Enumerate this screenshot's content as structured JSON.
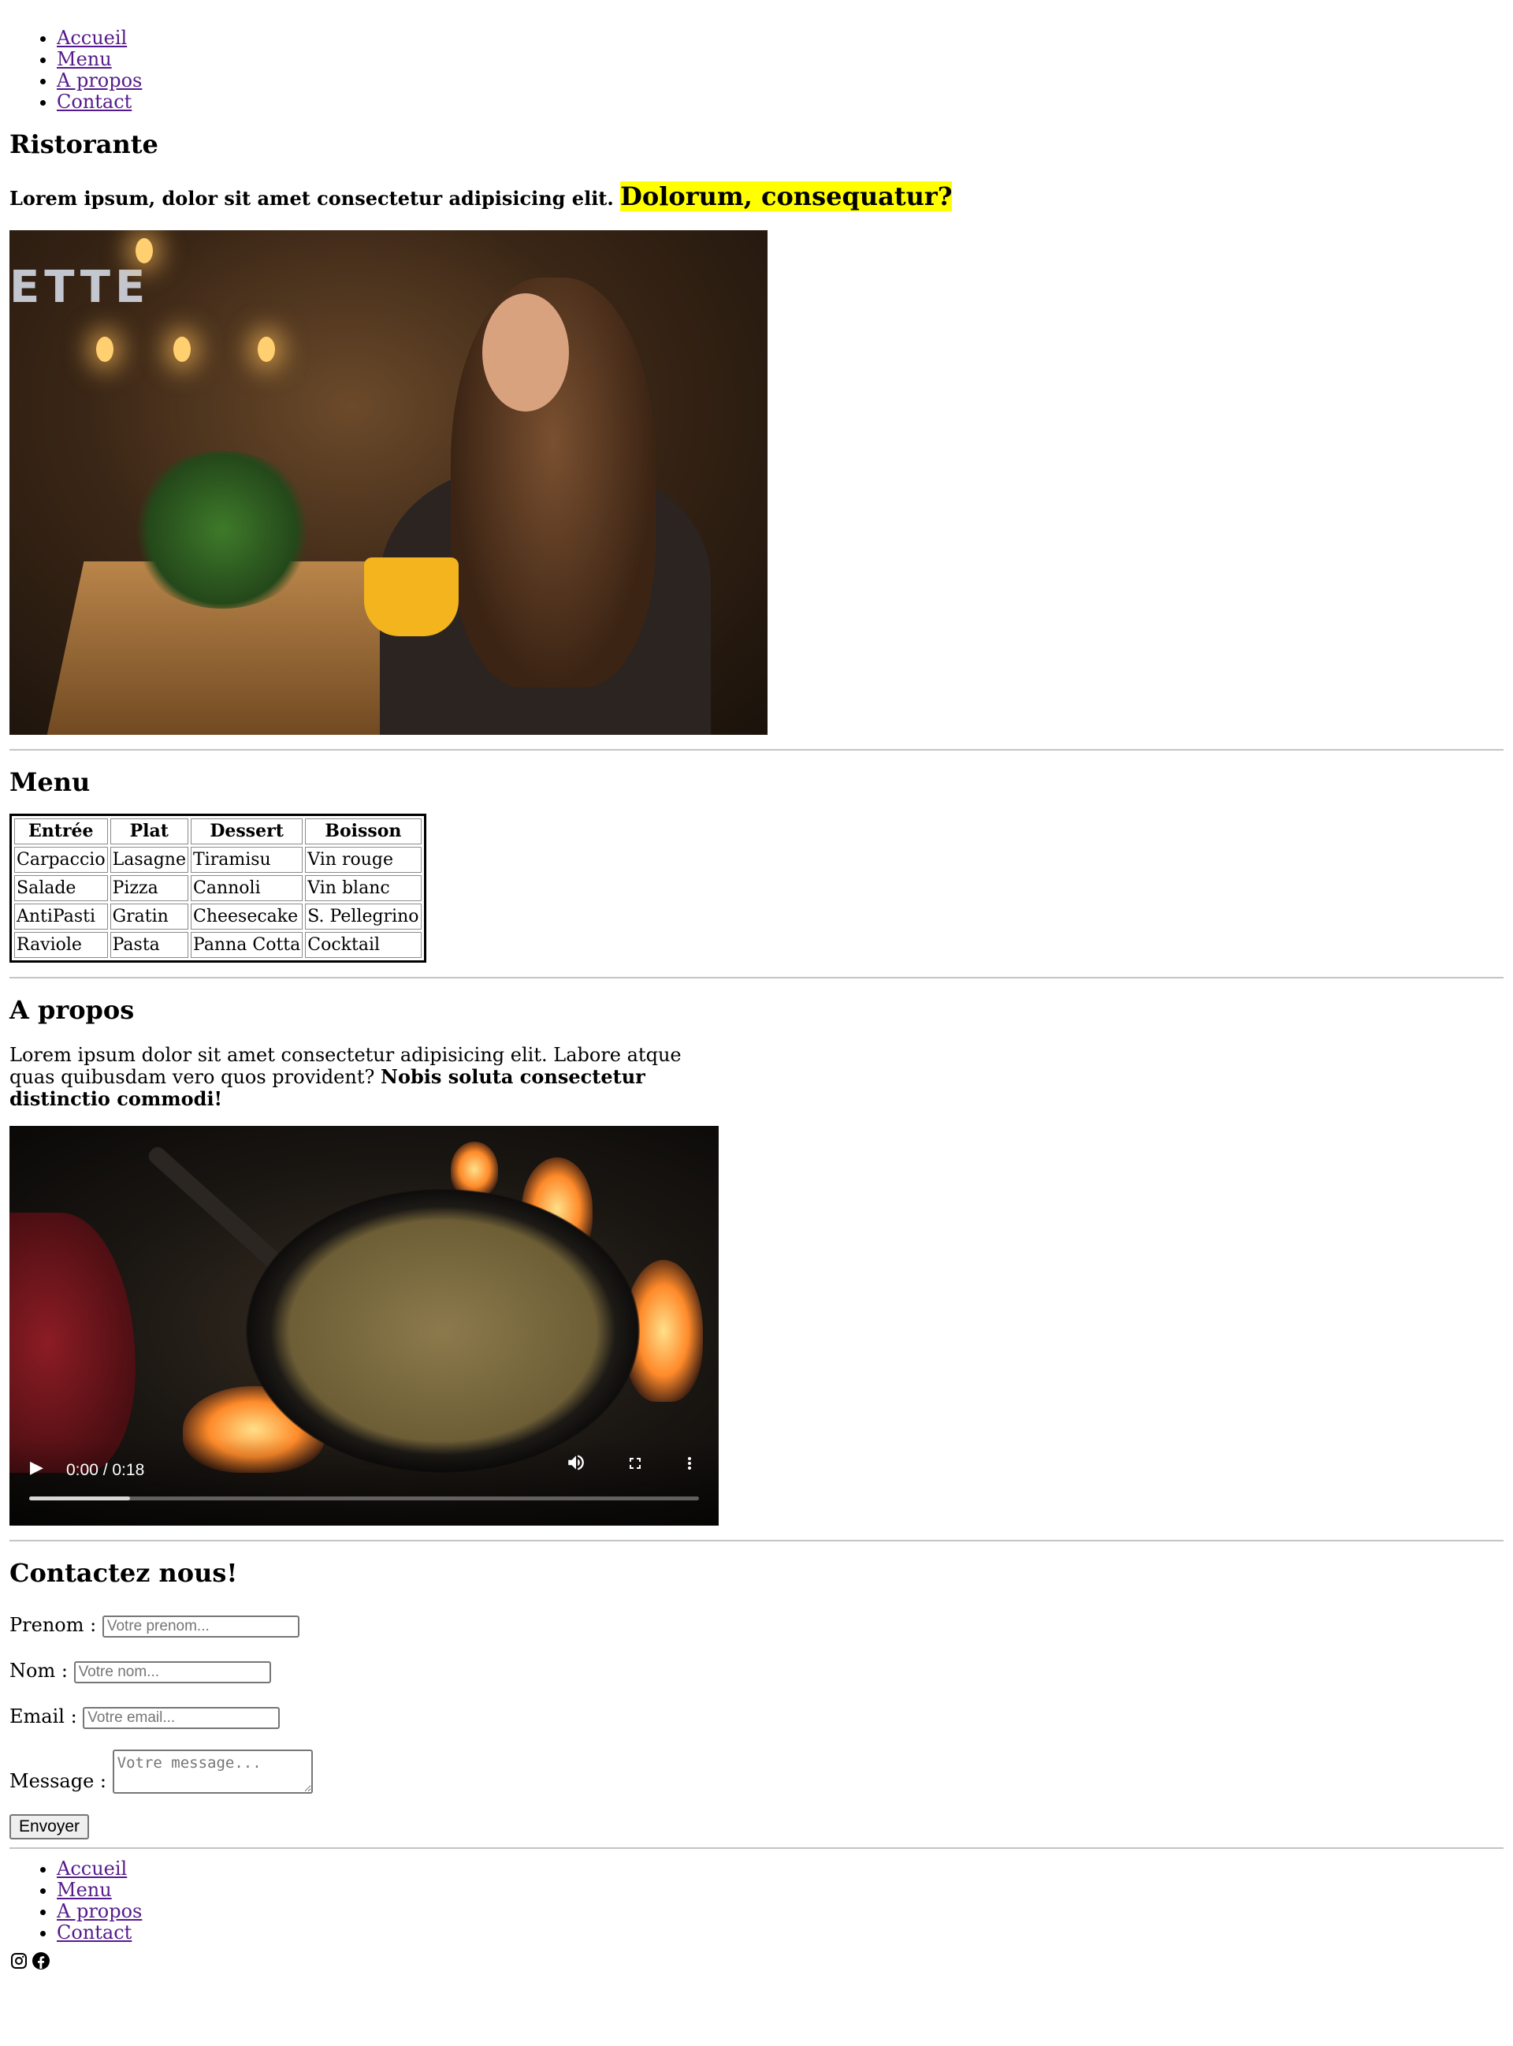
{
  "nav": {
    "items": [
      {
        "label": "Accueil"
      },
      {
        "label": "Menu"
      },
      {
        "label": "A propos"
      },
      {
        "label": "Contact"
      }
    ]
  },
  "hero": {
    "title": "Ristorante",
    "lead_text": "Lorem ipsum, dolor sit amet consectetur adipisicing elit.",
    "lead_highlight": "Dolorum, consequatur?",
    "highlight_color": "#ffff00",
    "sign_text": "ETTE"
  },
  "menu": {
    "title": "Menu",
    "columns": [
      "Entrée",
      "Plat",
      "Dessert",
      "Boisson"
    ],
    "rows": [
      [
        "Carpaccio",
        "Lasagne",
        "Tiramisu",
        "Vin rouge"
      ],
      [
        "Salade",
        "Pizza",
        "Cannoli",
        "Vin blanc"
      ],
      [
        "AntiPasti",
        "Gratin",
        "Cheesecake",
        "S. Pellegrino"
      ],
      [
        "Raviole",
        "Pasta",
        "Panna Cotta",
        "Cocktail"
      ]
    ]
  },
  "about": {
    "title": "A propos",
    "text": "Lorem ipsum dolor sit amet consectetur adipisicing elit. Labore atque quas quibusdam vero quos provident?",
    "bold_text": "Nobis soluta consectetur distinctio commodi!",
    "video": {
      "time": "0:00 / 0:18",
      "buffered_fraction": 0.15,
      "play_icon": "play-icon",
      "volume_icon": "volume-icon",
      "fullscreen_icon": "fullscreen-icon",
      "more_icon": "more-options-icon"
    }
  },
  "contact": {
    "title": "Contactez nous!",
    "fields": {
      "prenom": {
        "label": "Prenom :",
        "placeholder": "Votre prenom..."
      },
      "nom": {
        "label": "Nom :",
        "placeholder": "Votre nom..."
      },
      "email": {
        "label": "Email :",
        "placeholder": "Votre email..."
      },
      "message": {
        "label": "Message :",
        "placeholder": "Votre message..."
      }
    },
    "submit_label": "Envoyer"
  },
  "footer": {
    "nav": [
      {
        "label": "Accueil"
      },
      {
        "label": "Menu"
      },
      {
        "label": "A propos"
      },
      {
        "label": "Contact"
      }
    ],
    "social": [
      "instagram-icon",
      "facebook-icon"
    ]
  }
}
